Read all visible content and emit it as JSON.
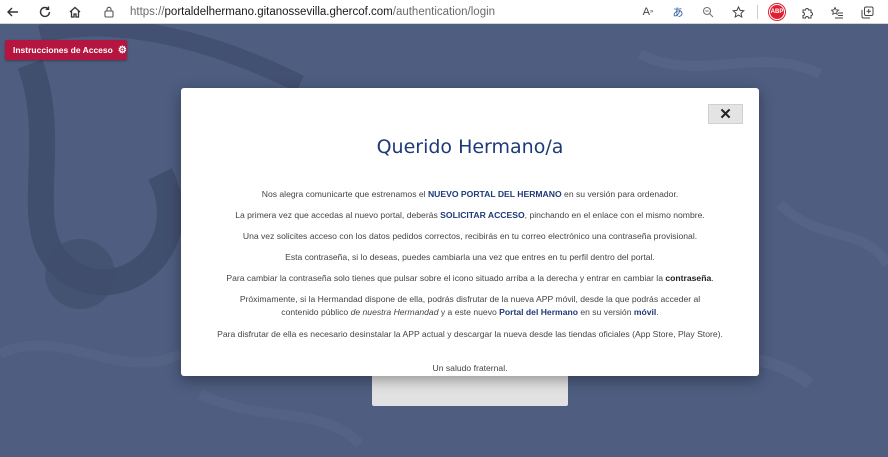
{
  "browser": {
    "url_prefix": "https://",
    "url_domain": "portaldelhermano.gitanossevilla.ghercof.com",
    "url_path": "/authentication/login",
    "read_aloud_icon": "A",
    "translate_icon": "あ",
    "abp_label": "ABP"
  },
  "page": {
    "access_button_label": "Instrucciones de Acceso"
  },
  "modal": {
    "close_label": "✕",
    "title": "Querido Hermano/a",
    "p1_a": "Nos alegra comunicarte que estrenamos el ",
    "p1_b": "NUEVO PORTAL DEL HERMANO",
    "p1_c": " en su versión para ordenador.",
    "p2_a": "La primera vez que accedas al nuevo portal, deberás ",
    "p2_b": "SOLICITAR ACCESO",
    "p2_c": ", pinchando en el enlace con el mismo nombre.",
    "p3": "Una vez solicites acceso con los datos pedidos correctos, recibirás en tu correo electrónico una contraseña provisional.",
    "p4": "Esta contraseña, si lo deseas, puedes cambiarla una vez que entres en tu perfil dentro del portal.",
    "p5_a": "Para cambiar la contraseña solo tienes que pulsar sobre el icono situado arriba a la derecha y entrar en cambiar la ",
    "p5_b": "contraseña",
    "p5_c": ".",
    "p6_a": "Próximamente, si la Hermandad dispone de ella, podrás disfrutar de la nueva APP móvil, desde la que podrás acceder al contenido público ",
    "p6_b": "de nuestra Hermandad",
    "p6_c": " y a este nuevo ",
    "p6_d": "Portal del Hermano",
    "p6_e": " en su versión ",
    "p6_f": "móvil",
    "p6_g": ".",
    "p7": "Para disfrutar de ella es necesario desinstalar la APP actual y descargar la nueva desde las tiendas oficiales (App Store, Play Store).",
    "p8": "Un saludo fraternal."
  },
  "colors": {
    "background": "#4e5d80",
    "accent_button": "#b5163f",
    "title_blue": "#1d3a78"
  }
}
